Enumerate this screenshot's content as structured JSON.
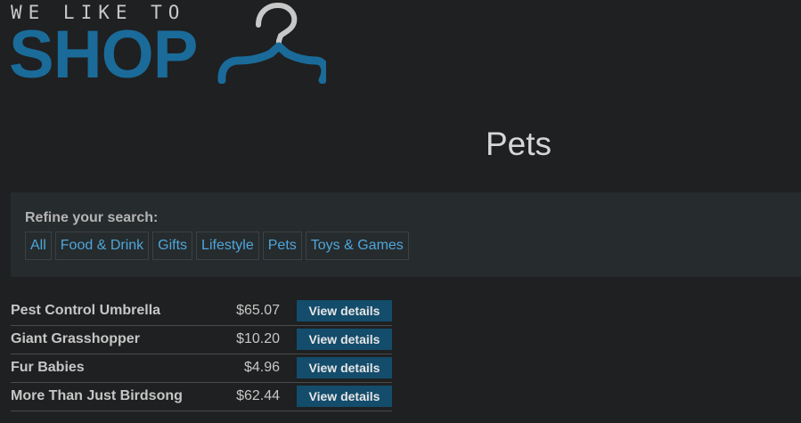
{
  "logo": {
    "tagline": "WE LIKE TO",
    "word": "SHOP",
    "icon": "hanger-icon",
    "colors": {
      "tagline": "#c8c8c8",
      "word": "#1a6b99",
      "hanger_hook": "#c8c8c8",
      "hanger_body": "#1a6b99"
    }
  },
  "page": {
    "title": "Pets",
    "background": "#1f2021"
  },
  "refine": {
    "label": "Refine your search:",
    "filters": [
      {
        "label": "All"
      },
      {
        "label": "Food & Drink"
      },
      {
        "label": "Gifts"
      },
      {
        "label": "Lifestyle"
      },
      {
        "label": "Pets"
      },
      {
        "label": "Toys & Games"
      }
    ]
  },
  "products": [
    {
      "name": "Pest Control Umbrella",
      "price": "$65.07",
      "button": "View details"
    },
    {
      "name": "Giant Grasshopper",
      "price": "$10.20",
      "button": "View details"
    },
    {
      "name": "Fur Babies",
      "price": "$4.96",
      "button": "View details"
    },
    {
      "name": "More Than Just Birdsong",
      "price": "$62.44",
      "button": "View details"
    }
  ]
}
